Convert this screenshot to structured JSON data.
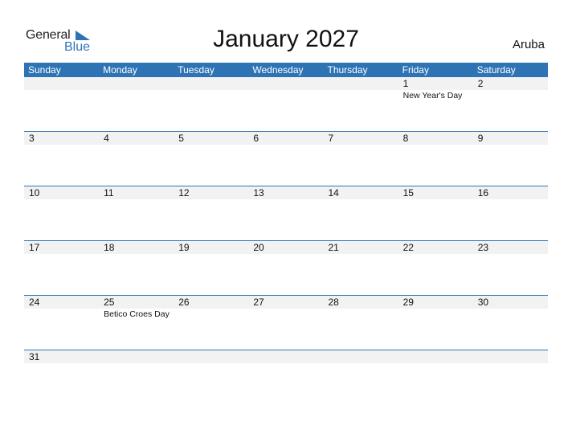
{
  "brand": {
    "line1": "General",
    "line2": "Blue",
    "accent": "#2e74b5"
  },
  "title": "January 2027",
  "country": "Aruba",
  "colors": {
    "header_bg": "#2e74b5",
    "strip_bg": "#f2f2f2"
  },
  "weekdays": [
    "Sunday",
    "Monday",
    "Tuesday",
    "Wednesday",
    "Thursday",
    "Friday",
    "Saturday"
  ],
  "weeks": [
    [
      {
        "day": ""
      },
      {
        "day": ""
      },
      {
        "day": ""
      },
      {
        "day": ""
      },
      {
        "day": ""
      },
      {
        "day": "1",
        "holiday": "New Year's Day"
      },
      {
        "day": "2"
      }
    ],
    [
      {
        "day": "3"
      },
      {
        "day": "4"
      },
      {
        "day": "5"
      },
      {
        "day": "6"
      },
      {
        "day": "7"
      },
      {
        "day": "8"
      },
      {
        "day": "9"
      }
    ],
    [
      {
        "day": "10"
      },
      {
        "day": "11"
      },
      {
        "day": "12"
      },
      {
        "day": "13"
      },
      {
        "day": "14"
      },
      {
        "day": "15"
      },
      {
        "day": "16"
      }
    ],
    [
      {
        "day": "17"
      },
      {
        "day": "18"
      },
      {
        "day": "19"
      },
      {
        "day": "20"
      },
      {
        "day": "21"
      },
      {
        "day": "22"
      },
      {
        "day": "23"
      }
    ],
    [
      {
        "day": "24"
      },
      {
        "day": "25",
        "holiday": "Betico Croes Day"
      },
      {
        "day": "26"
      },
      {
        "day": "27"
      },
      {
        "day": "28"
      },
      {
        "day": "29"
      },
      {
        "day": "30"
      }
    ],
    [
      {
        "day": "31"
      },
      {
        "day": ""
      },
      {
        "day": ""
      },
      {
        "day": ""
      },
      {
        "day": ""
      },
      {
        "day": ""
      },
      {
        "day": ""
      }
    ]
  ]
}
